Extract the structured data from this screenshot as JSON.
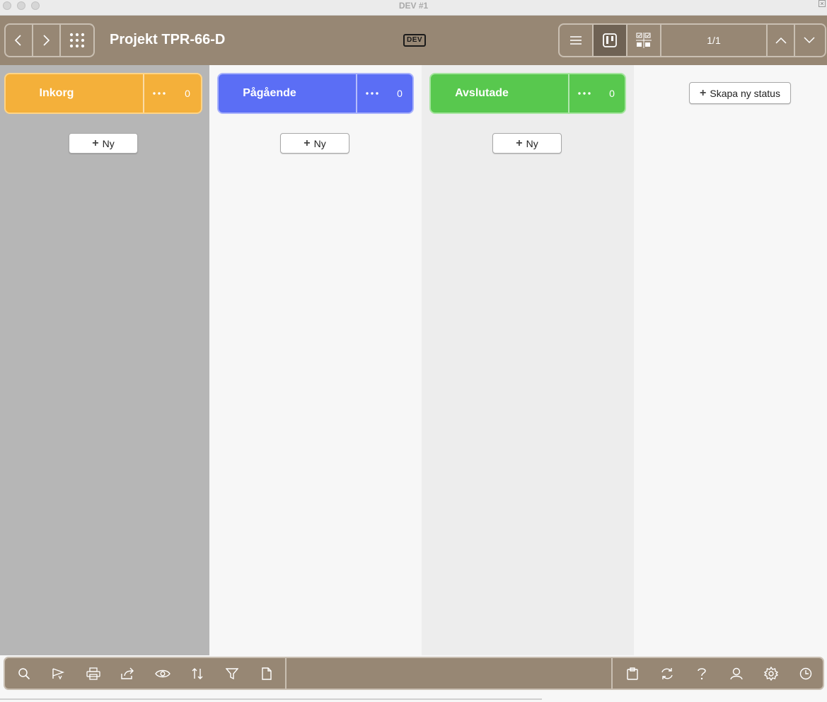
{
  "window": {
    "title": "DEV #1"
  },
  "header": {
    "title": "Projekt TPR-66-D",
    "badge": "DEV",
    "pager": "1/1"
  },
  "board": {
    "columns": [
      {
        "name": "Inkorg",
        "count": "0",
        "new_label": "Ny",
        "color": "#f4b03a"
      },
      {
        "name": "Pågående",
        "count": "0",
        "new_label": "Ny",
        "color": "#5b6ef5"
      },
      {
        "name": "Avslutade",
        "count": "0",
        "new_label": "Ny",
        "color": "#58c84e"
      }
    ],
    "create_status_label": "Skapa ny status"
  },
  "toolbar": {
    "left_icons": [
      "search-icon",
      "flag-icon",
      "print-icon",
      "share-icon",
      "eye-icon",
      "sort-icon",
      "filter-icon",
      "document-icon"
    ],
    "right_icons": [
      "clipboard-icon",
      "refresh-icon",
      "help-icon",
      "user-icon",
      "gear-icon",
      "clock-icon"
    ]
  },
  "colors": {
    "header_bg": "#978774",
    "accent_border": "#c9bfb2"
  }
}
